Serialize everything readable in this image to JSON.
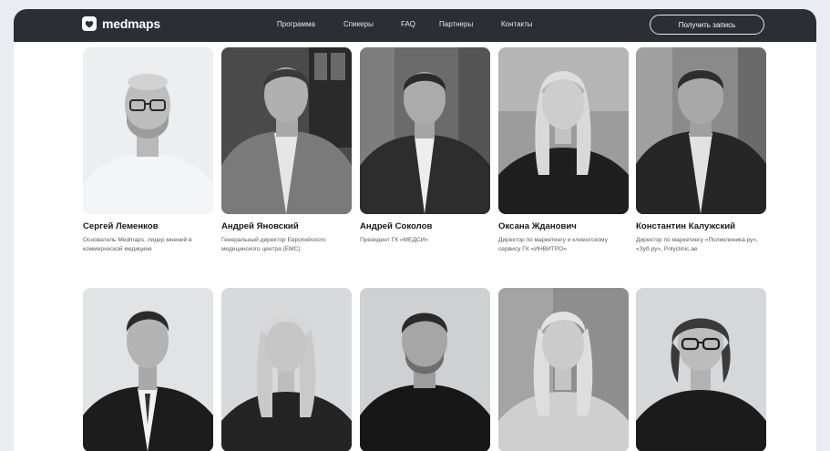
{
  "nav": {
    "brand": "medmaps",
    "links": [
      "Программа",
      "Спикеры",
      "FAQ",
      "Партнеры",
      "Контакты"
    ],
    "cta": "Получить запись"
  },
  "speakers": [
    {
      "name": "Сергей Леменков",
      "role": "Основатель Medmaps, лидер мнений в коммерческой медицине"
    },
    {
      "name": "Андрей Яновский",
      "role": "Генеральный директор Европейского медицинского центра (EMC)"
    },
    {
      "name": "Андрей Соколов",
      "role": "Президент ГК «МЕДСИ»"
    },
    {
      "name": "Оксана Жданович",
      "role": "Директор по маркетингу и клиентскому сервису ГК «ИНВИТРО»"
    },
    {
      "name": "Константин Калужский",
      "role": "Директор по маркетингу «Поликлиника.ру», «Зуб.ру», Polyclinic.ae"
    }
  ],
  "colors": {
    "nav_bg": "#2b2e35",
    "page_bg": "#e9ecf1",
    "card_text": "#15171b",
    "muted_text": "#555a62"
  }
}
